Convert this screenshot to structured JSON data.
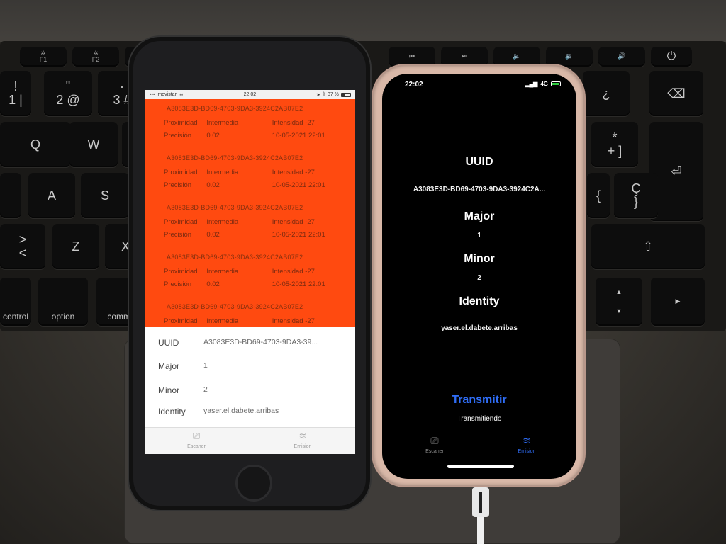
{
  "left_phone": {
    "status_bar": {
      "carrier": "movistar",
      "time": "22:02",
      "battery": "37 %"
    },
    "beacons": [
      {
        "uuid": "A3083E3D-BD69-4703-9DA3-3924C2AB07E2",
        "proximity_label": "Proximidad",
        "proximity": "Intermedia",
        "intensity": "Intensidad -27",
        "precision_label": "Precisión",
        "precision": "0.02",
        "datetime": "10-05-2021 22:01"
      },
      {
        "uuid": "A3083E3D-BD69-4703-9DA3-3924C2AB07E2",
        "proximity_label": "Proximidad",
        "proximity": "Intermedia",
        "intensity": "Intensidad -27",
        "precision_label": "Precisión",
        "precision": "0.02",
        "datetime": "10-05-2021 22:01"
      },
      {
        "uuid": "A3083E3D-BD69-4703-9DA3-3924C2AB07E2",
        "proximity_label": "Proximidad",
        "proximity": "Intermedia",
        "intensity": "Intensidad -27",
        "precision_label": "Precisión",
        "precision": "0.02",
        "datetime": "10-05-2021 22:01"
      },
      {
        "uuid": "A3083E3D-BD69-4703-9DA3-3924C2AB07E2",
        "proximity_label": "Proximidad",
        "proximity": "Intermedia",
        "intensity": "Intensidad -27",
        "precision_label": "Precisión",
        "precision": "0.02",
        "datetime": "10-05-2021 22:01"
      },
      {
        "uuid": "A3083E3D-BD69-4703-9DA3-3924C2AB07E2",
        "proximity_label": "Proximidad",
        "proximity": "Intermedia",
        "intensity": "Intensidad -27"
      }
    ],
    "config": {
      "uuid_label": "UUID",
      "uuid": "A3083E3D-BD69-4703-9DA3-39...",
      "major_label": "Major",
      "major": "1",
      "minor_label": "Minor",
      "minor": "2",
      "identity_label": "Identity",
      "identity": "yaser.el.dabete.arribas"
    },
    "tabs": {
      "scanner": "Escaner",
      "emission": "Emision"
    }
  },
  "right_phone": {
    "status_bar": {
      "time": "22:02",
      "network": "4G"
    },
    "uuid_label": "UUID",
    "uuid": "A3083E3D-BD69-4703-9DA3-3924C2A...",
    "major_label": "Major",
    "major": "1",
    "minor_label": "Minor",
    "minor": "2",
    "identity_label": "Identity",
    "identity": "yaser.el.dabete.arribas",
    "transmit_button": "Transmitir",
    "transmit_status": "Transmitiendo",
    "tabs": {
      "scanner": "Escaner",
      "emission": "Emision"
    }
  },
  "keyboard": {
    "keys": {
      "k1": "!\n1 |",
      "k2": "\"\n2 @",
      "k3": "·\n3 #",
      "q": "Q",
      "w": "W",
      "a": "A",
      "s": "S",
      "angle": ">\n<",
      "z": "Z",
      "x": "X",
      "control": "control",
      "option": "option",
      "command": "comma",
      "question": "¿",
      "backspace": "⌫",
      "plus": "*\n+ ]",
      "enter": "⏎",
      "brace": "{",
      "c_cedilla": "Ç\n}",
      "shift": "⇧",
      "up": "▲",
      "down": "▼",
      "right": "▶",
      "power": "⏻",
      "f1": "F1",
      "f2": "F2"
    }
  }
}
